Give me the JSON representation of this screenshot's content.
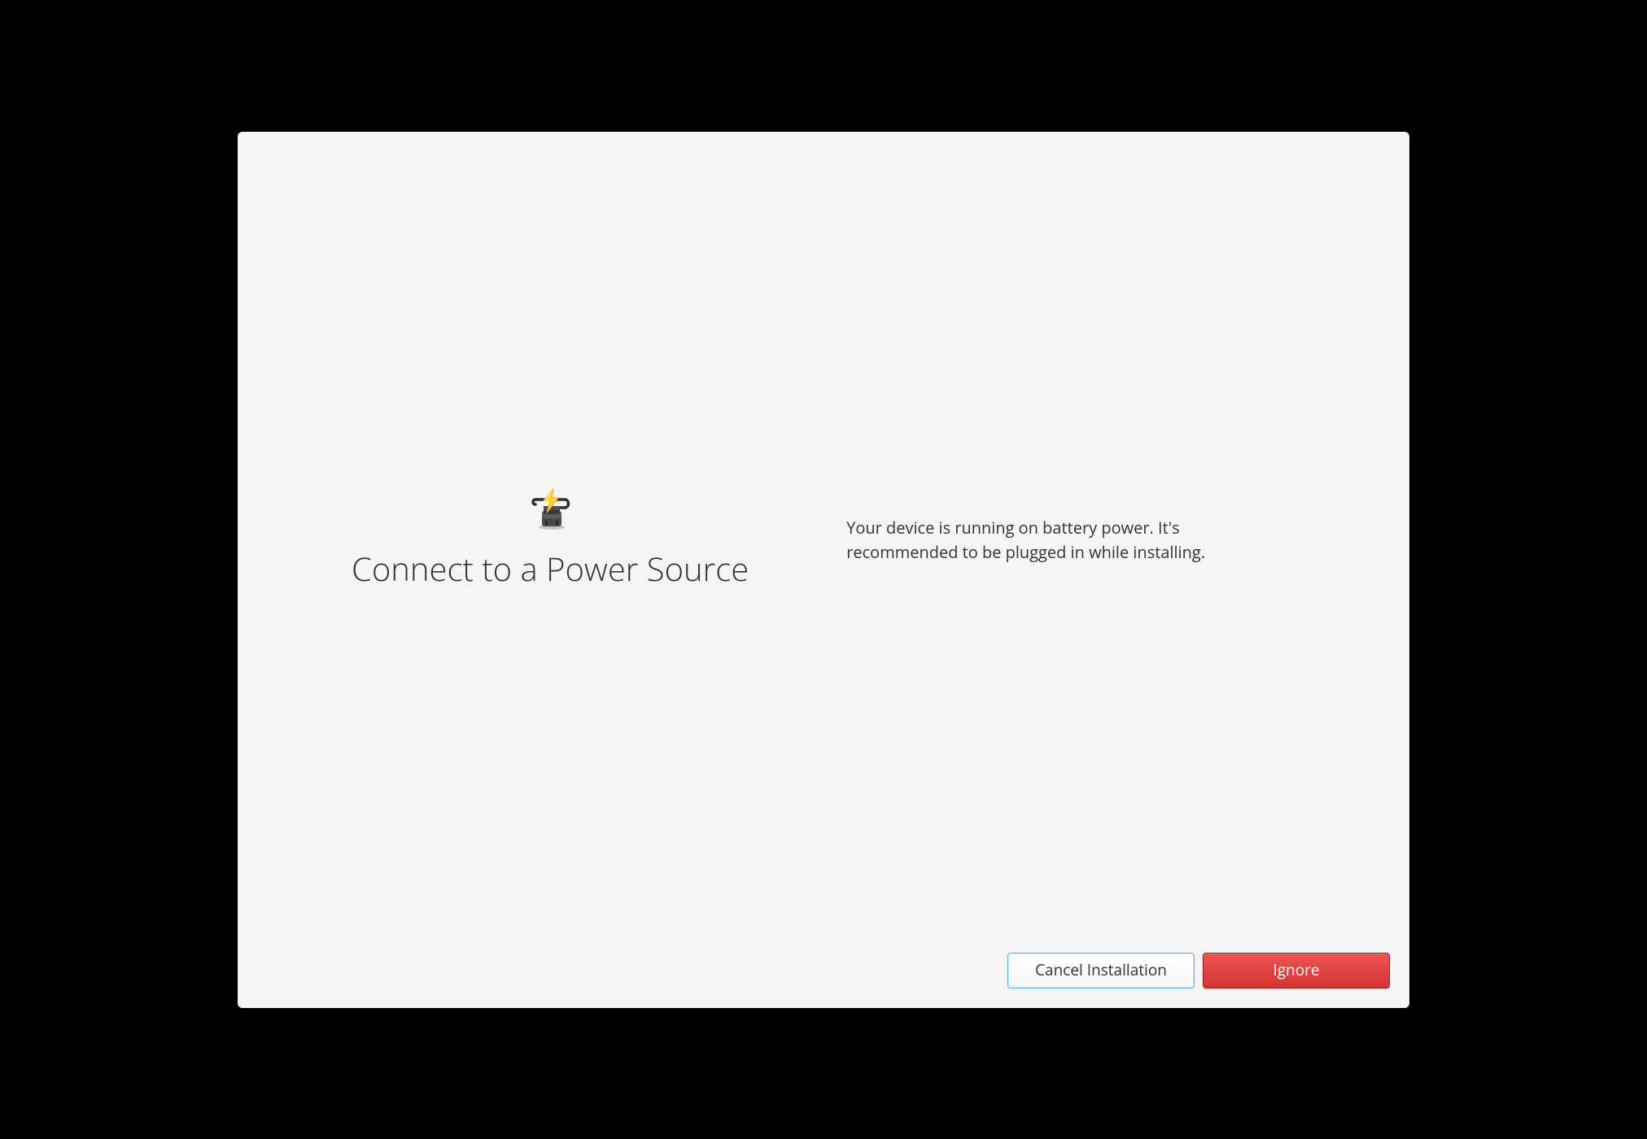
{
  "dialog": {
    "heading": "Connect to a Power Source",
    "description": "Your device is running on battery power. It's recommended to be plugged in while installing.",
    "buttons": {
      "cancel_label": "Cancel Installation",
      "ignore_label": "Ignore"
    }
  }
}
